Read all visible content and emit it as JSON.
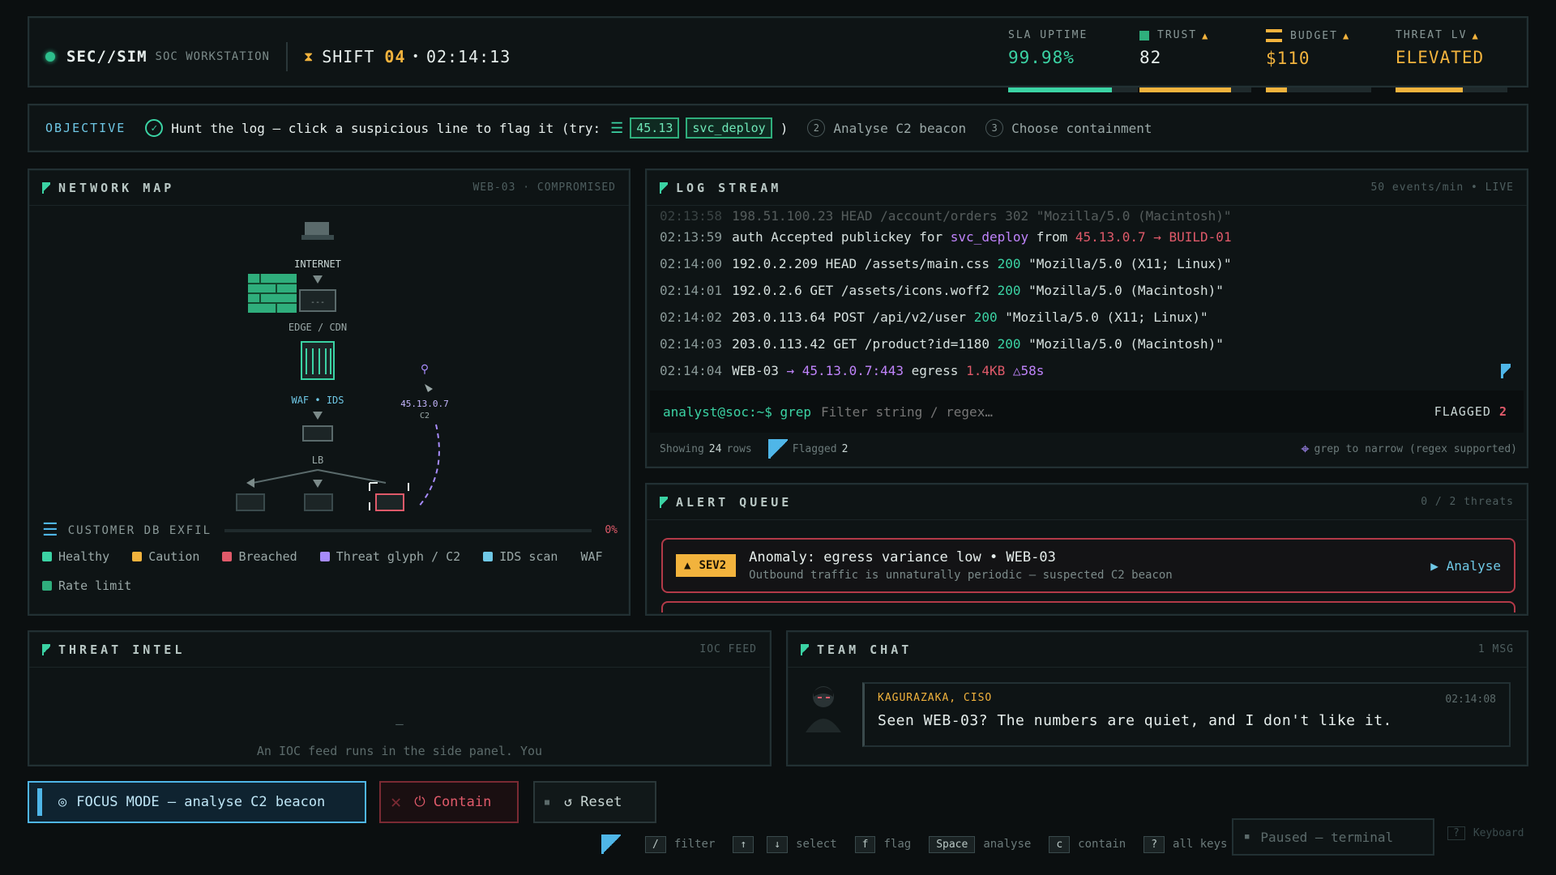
{
  "topbar": {
    "brand": "SEC//SIM",
    "brand_sub": "SOC WORKSTATION",
    "shift_label": "SHIFT",
    "shift_num": "04",
    "shift_sep": "•",
    "clock": "02:14:13",
    "stats": [
      {
        "label": "SLA UPTIME",
        "value": "99.98%",
        "color": "#3bd3a4",
        "progress": 0.8
      },
      {
        "label": "TRUST",
        "value": "82",
        "color": "#e6eeec",
        "progress": 0.82,
        "warn": "▲"
      },
      {
        "label": "BUDGET",
        "value": "$110",
        "color": "#f2b33d",
        "progress": 0.2,
        "warn": "▲"
      },
      {
        "label": "THREAT LV",
        "value": "ELEVATED",
        "color": "#f2b33d",
        "progress": 0.6,
        "warn": "▲"
      }
    ]
  },
  "objective": {
    "label": "OBJECTIVE",
    "step1": "Hunt the log — click a suspicious line to flag it (try:",
    "chip1": "45.13",
    "chip2": "svc_deploy",
    "close_paren": ")",
    "step2_num": "2",
    "step2": "Analyse C2 beacon",
    "step3_num": "3",
    "step3": "Choose containment"
  },
  "netmap": {
    "title": "NETWORK MAP",
    "meta": "WEB-03 · COMPROMISED",
    "nodes": {
      "internet": "INTERNET",
      "edge": "EDGE / CDN",
      "waf": "WAF • IDS",
      "lb": "LB",
      "c2_ip": "45.13.0.7",
      "c2": "C2"
    },
    "exfil_label": "CUSTOMER DB EXFIL",
    "exfil_pct": "0%",
    "legend": [
      {
        "label": "Healthy",
        "color": "#3bd3a4"
      },
      {
        "label": "Caution",
        "color": "#f2b33d"
      },
      {
        "label": "Breached",
        "color": "#e05a6a"
      },
      {
        "label": "Threat glyph / C2",
        "color": "#a78bfa"
      },
      {
        "label": "IDS scan",
        "color": "#6fc8e6"
      },
      {
        "label": "WAF",
        "color": ""
      },
      {
        "label": "Rate limit",
        "color": "#2fae7c"
      }
    ]
  },
  "logstream": {
    "title": "LOG STREAM",
    "meta": "50 events/min • LIVE",
    "faded": {
      "t": "02:13:58",
      "m": "198.51.100.23 HEAD /account/orders 302 \"Mozilla/5.0 (Macintosh)\""
    },
    "lines": [
      {
        "t": "02:13:59",
        "parts": [
          [
            "auth Accepted publickey for ",
            "#d6e0de"
          ],
          [
            "svc_deploy",
            "#c084fc"
          ],
          [
            " from ",
            "#d6e0de"
          ],
          [
            "45.13.0.7",
            "#e05a6a"
          ],
          [
            " → BUILD-01",
            "#e05a6a"
          ]
        ]
      },
      {
        "t": "02:14:00",
        "parts": [
          [
            "192.0.2.209 HEAD /assets/main.css ",
            "#d6e0de"
          ],
          [
            "200",
            "#3bd3a4"
          ],
          [
            " \"Mozilla/5.0 (X11; Linux)\"",
            "#d6e0de"
          ]
        ]
      },
      {
        "t": "02:14:01",
        "parts": [
          [
            "192.0.2.6 GET /assets/icons.woff2 ",
            "#d6e0de"
          ],
          [
            "200",
            "#3bd3a4"
          ],
          [
            " \"Mozilla/5.0 (Macintosh)\"",
            "#d6e0de"
          ]
        ]
      },
      {
        "t": "02:14:02",
        "parts": [
          [
            "203.0.113.64 POST /api/v2/user ",
            "#d6e0de"
          ],
          [
            "200",
            "#3bd3a4"
          ],
          [
            " \"Mozilla/5.0 (X11; Linux)\"",
            "#d6e0de"
          ]
        ]
      },
      {
        "t": "02:14:03",
        "parts": [
          [
            "203.0.113.42 GET /product?id=1180 ",
            "#d6e0de"
          ],
          [
            "200",
            "#3bd3a4"
          ],
          [
            " \"Mozilla/5.0 (Macintosh)\"",
            "#d6e0de"
          ]
        ]
      },
      {
        "t": "02:14:04",
        "parts": [
          [
            "WEB-03 ",
            "#d6e0de"
          ],
          [
            "→ 45.13.0.7:443",
            "#c084fc"
          ],
          [
            " egress ",
            "#d6e0de"
          ],
          [
            "1.4KB",
            "#e05a6a"
          ],
          [
            " △58s",
            "#c084fc"
          ]
        ]
      }
    ],
    "prompt": "analyst@soc:~$ grep",
    "grep_placeholder": "Filter string / regex…",
    "flagged_label": "FLAGGED",
    "flagged_count": "2",
    "showing_label": "Showing",
    "showing_count": "24",
    "showing_unit": "rows",
    "flagged_foot_label": "Flagged",
    "flagged_foot_count": "2",
    "hint": "grep to narrow (regex supported)"
  },
  "alerts": {
    "title": "ALERT QUEUE",
    "meta": "0 / 2 threats",
    "card": {
      "sev": "SEV2",
      "title": "Anomaly: egress variance low • WEB-03",
      "sub": "Outbound traffic is unnaturally periodic — suspected C2 beacon",
      "action": "Analyse"
    }
  },
  "intel": {
    "title": "THREAT INTEL",
    "meta": "IOC FEED",
    "dash": "—",
    "text": "An IOC feed runs in the side panel. You"
  },
  "chat": {
    "title": "TEAM CHAT",
    "meta": "1 MSG",
    "author": "KAGURAZAKA, CISO",
    "time": "02:14:08",
    "message": "Seen WEB-03? The numbers are quiet, and I don't like it."
  },
  "actions": {
    "focus": "FOCUS MODE — analyse C2 beacon",
    "contain": "Contain",
    "reset": "Reset"
  },
  "hotkeys": [
    {
      "key": "/",
      "label": "filter"
    },
    {
      "key": "↑",
      "label": ""
    },
    {
      "key": "↓",
      "label": "select"
    },
    {
      "key": "f",
      "label": "flag"
    },
    {
      "key": "Space",
      "label": "analyse"
    },
    {
      "key": "c",
      "label": "contain"
    },
    {
      "key": "?",
      "label": "all keys"
    }
  ],
  "paused": "Paused — terminal",
  "keyboard": "Keyboard",
  "keyboard_key": "?"
}
